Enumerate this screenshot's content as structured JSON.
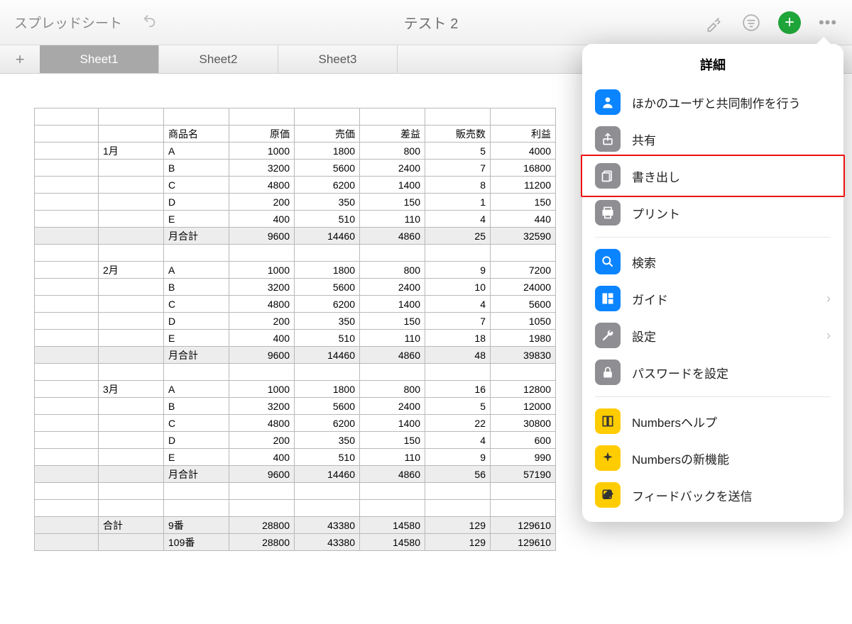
{
  "toolbar": {
    "back_label": "スプレッドシート",
    "doc_title": "テスト 2"
  },
  "tabs": [
    "Sheet1",
    "Sheet2",
    "Sheet3"
  ],
  "active_tab": 0,
  "headers": [
    "",
    "",
    "商品名",
    "原価",
    "売価",
    "差益",
    "販売数",
    "利益"
  ],
  "rows": [
    [
      "",
      "1月",
      "A",
      "1000",
      "1800",
      "800",
      "5",
      "4000"
    ],
    [
      "",
      "",
      "B",
      "3200",
      "5600",
      "2400",
      "7",
      "16800"
    ],
    [
      "",
      "",
      "C",
      "4800",
      "6200",
      "1400",
      "8",
      "11200"
    ],
    [
      "",
      "",
      "D",
      "200",
      "350",
      "150",
      "1",
      "150"
    ],
    [
      "",
      "",
      "E",
      "400",
      "510",
      "110",
      "4",
      "440"
    ],
    [
      "",
      "",
      "月合計",
      "9600",
      "14460",
      "4860",
      "25",
      "32590"
    ],
    [
      "",
      "",
      "",
      "",
      "",
      "",
      "",
      ""
    ],
    [
      "",
      "2月",
      "A",
      "1000",
      "1800",
      "800",
      "9",
      "7200"
    ],
    [
      "",
      "",
      "B",
      "3200",
      "5600",
      "2400",
      "10",
      "24000"
    ],
    [
      "",
      "",
      "C",
      "4800",
      "6200",
      "1400",
      "4",
      "5600"
    ],
    [
      "",
      "",
      "D",
      "200",
      "350",
      "150",
      "7",
      "1050"
    ],
    [
      "",
      "",
      "E",
      "400",
      "510",
      "110",
      "18",
      "1980"
    ],
    [
      "",
      "",
      "月合計",
      "9600",
      "14460",
      "4860",
      "48",
      "39830"
    ],
    [
      "",
      "",
      "",
      "",
      "",
      "",
      "",
      ""
    ],
    [
      "",
      "3月",
      "A",
      "1000",
      "1800",
      "800",
      "16",
      "12800"
    ],
    [
      "",
      "",
      "B",
      "3200",
      "5600",
      "2400",
      "5",
      "12000"
    ],
    [
      "",
      "",
      "C",
      "4800",
      "6200",
      "1400",
      "22",
      "30800"
    ],
    [
      "",
      "",
      "D",
      "200",
      "350",
      "150",
      "4",
      "600"
    ],
    [
      "",
      "",
      "E",
      "400",
      "510",
      "110",
      "9",
      "990"
    ],
    [
      "",
      "",
      "月合計",
      "9600",
      "14460",
      "4860",
      "56",
      "57190"
    ],
    [
      "",
      "",
      "",
      "",
      "",
      "",
      "",
      ""
    ],
    [
      "",
      "",
      "",
      "",
      "",
      "",
      "",
      ""
    ],
    [
      "",
      "合計",
      "9番",
      "28800",
      "43380",
      "14580",
      "129",
      "129610"
    ],
    [
      "",
      "",
      "109番",
      "28800",
      "43380",
      "14580",
      "129",
      "129610"
    ]
  ],
  "popover": {
    "title": "詳細",
    "groups": [
      [
        {
          "id": "collaborate",
          "label": "ほかのユーザと共同制作を行う",
          "icon": "person",
          "color": "ic-blue"
        },
        {
          "id": "share",
          "label": "共有",
          "icon": "share",
          "color": "ic-gray"
        },
        {
          "id": "export",
          "label": "書き出し",
          "icon": "export",
          "color": "ic-gray",
          "highlight": true
        },
        {
          "id": "print",
          "label": "プリント",
          "icon": "print",
          "color": "ic-gray"
        }
      ],
      [
        {
          "id": "search",
          "label": "検索",
          "icon": "search",
          "color": "ic-blue"
        },
        {
          "id": "guides",
          "label": "ガイド",
          "icon": "guides",
          "color": "ic-blue",
          "chevron": true
        },
        {
          "id": "settings",
          "label": "設定",
          "icon": "wrench",
          "color": "ic-gray",
          "chevron": true
        },
        {
          "id": "password",
          "label": "パスワードを設定",
          "icon": "lock",
          "color": "ic-gray"
        }
      ],
      [
        {
          "id": "help",
          "label": "Numbersヘルプ",
          "icon": "book",
          "color": "ic-yellow"
        },
        {
          "id": "whatsnew",
          "label": "Numbersの新機能",
          "icon": "spark",
          "color": "ic-yellow"
        },
        {
          "id": "feedback",
          "label": "フィードバックを送信",
          "icon": "compose",
          "color": "ic-yellow"
        }
      ]
    ]
  }
}
